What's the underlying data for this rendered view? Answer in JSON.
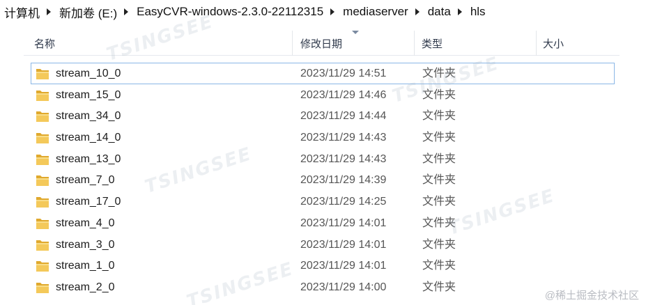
{
  "breadcrumb": [
    "计算机",
    "新加卷 (E:)",
    "EasyCVR-windows-2.3.0-22112315",
    "mediaserver",
    "data",
    "hls"
  ],
  "columns": {
    "name": "名称",
    "date": "修改日期",
    "type": "类型",
    "size": "大小"
  },
  "files": [
    {
      "name": "stream_10_0",
      "date": "2023/11/29 14:51",
      "type": "文件夹",
      "size": ""
    },
    {
      "name": "stream_15_0",
      "date": "2023/11/29 14:46",
      "type": "文件夹",
      "size": ""
    },
    {
      "name": "stream_34_0",
      "date": "2023/11/29 14:44",
      "type": "文件夹",
      "size": ""
    },
    {
      "name": "stream_14_0",
      "date": "2023/11/29 14:43",
      "type": "文件夹",
      "size": ""
    },
    {
      "name": "stream_13_0",
      "date": "2023/11/29 14:43",
      "type": "文件夹",
      "size": ""
    },
    {
      "name": "stream_7_0",
      "date": "2023/11/29 14:39",
      "type": "文件夹",
      "size": ""
    },
    {
      "name": "stream_17_0",
      "date": "2023/11/29 14:25",
      "type": "文件夹",
      "size": ""
    },
    {
      "name": "stream_4_0",
      "date": "2023/11/29 14:01",
      "type": "文件夹",
      "size": ""
    },
    {
      "name": "stream_3_0",
      "date": "2023/11/29 14:01",
      "type": "文件夹",
      "size": ""
    },
    {
      "name": "stream_1_0",
      "date": "2023/11/29 14:01",
      "type": "文件夹",
      "size": ""
    },
    {
      "name": "stream_2_0",
      "date": "2023/11/29 14:00",
      "type": "文件夹",
      "size": ""
    }
  ],
  "selected_index": 0,
  "icons": {
    "folder": "folder-icon",
    "separator": "chevron-right-icon",
    "sort": "sort-descending-icon"
  },
  "colors": {
    "selection_border": "#8ab6e6",
    "folder_fill": "#f2c14e",
    "header_text": "#303a4c"
  },
  "watermark": {
    "text": "TSINGSEE",
    "credit": "@稀土掘金技术社区"
  }
}
